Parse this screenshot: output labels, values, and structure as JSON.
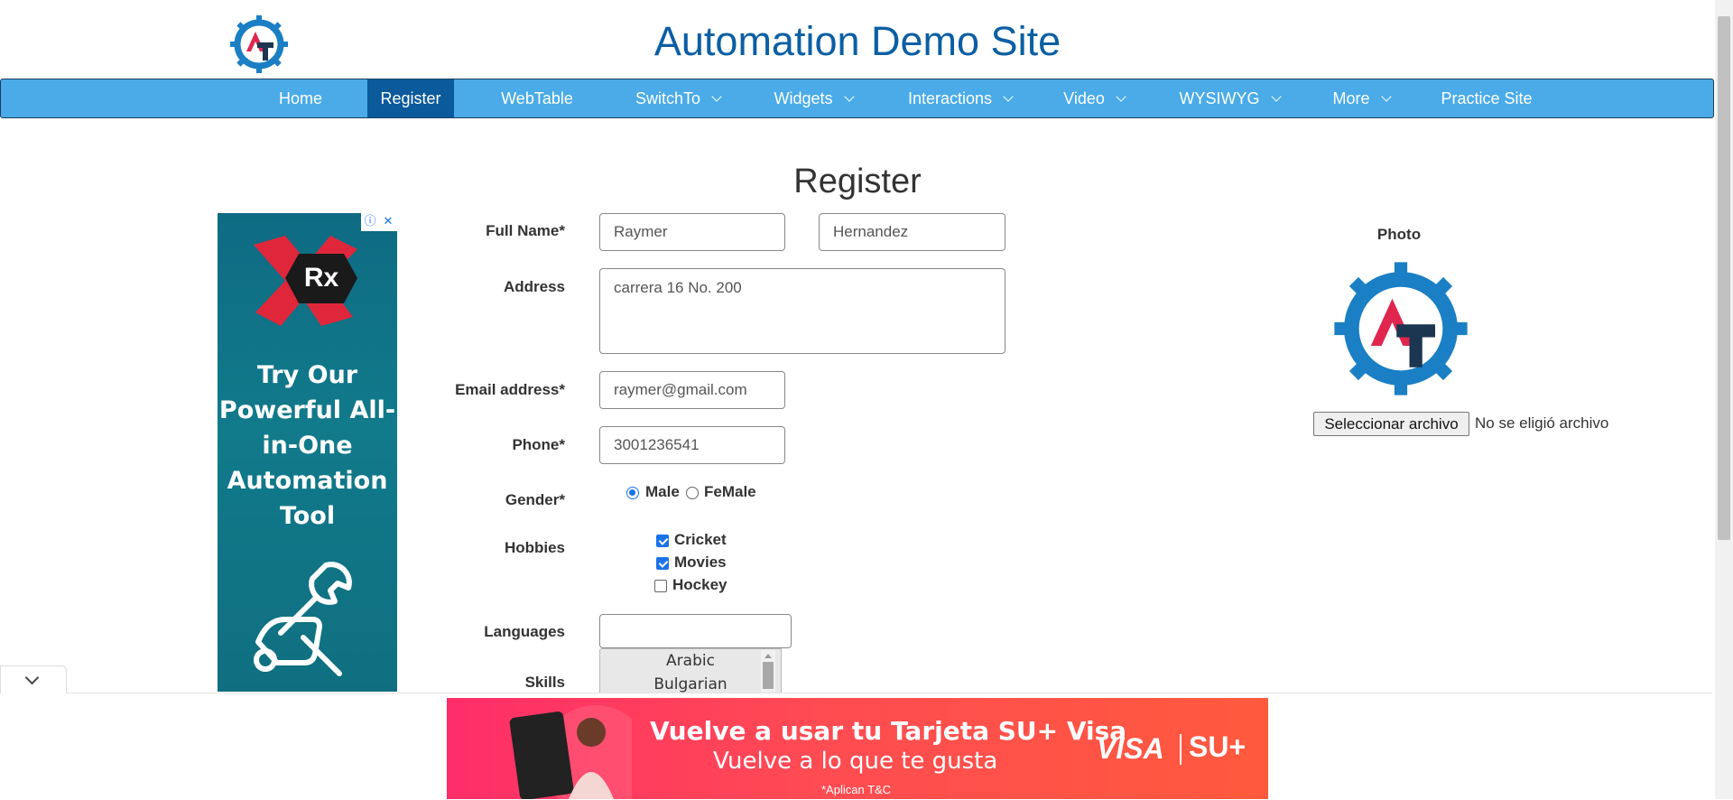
{
  "header": {
    "title": "Automation Demo Site",
    "logo": "gear-logo-icon"
  },
  "nav": {
    "items": [
      {
        "label": "Home"
      },
      {
        "label": "Register",
        "active": true
      },
      {
        "label": "WebTable"
      },
      {
        "label": "SwitchTo",
        "dropdown": true
      },
      {
        "label": "Widgets",
        "dropdown": true
      },
      {
        "label": "Interactions",
        "dropdown": true
      },
      {
        "label": "Video",
        "dropdown": true
      },
      {
        "label": "WYSIWYG",
        "dropdown": true
      },
      {
        "label": "More",
        "dropdown": true
      },
      {
        "label": "Practice Site"
      }
    ]
  },
  "page": {
    "heading": "Register"
  },
  "ad_left": {
    "badge_info": "ⓘ",
    "badge_close": "✕",
    "brand": "Rx",
    "text": "Try Our Powerful All-in-One Automation Tool"
  },
  "form": {
    "full_name_label": "Full Name*",
    "first_name": "Raymer",
    "last_name": "Hernandez",
    "address_label": "Address",
    "address": "carrera 16 No. 200",
    "email_label": "Email address*",
    "email": "raymer@gmail.com",
    "phone_label": "Phone*",
    "phone": "3001236541",
    "gender_label": "Gender*",
    "gender_male": "Male",
    "gender_female": "FeMale",
    "hobbies_label": "Hobbies",
    "hobby_cricket": "Cricket",
    "hobby_movies": "Movies",
    "hobby_hockey": "Hockey",
    "languages_label": "Languages",
    "languages_value": "",
    "skills_label": "Skills",
    "skills_options": [
      "Arabic",
      "Bulgarian"
    ]
  },
  "photo": {
    "label": "Photo",
    "button": "Seleccionar archivo",
    "status": "No se eligió archivo"
  },
  "bottom_ad": {
    "line1": "Vuelve a usar tu Tarjeta SU+ Visa",
    "line2": "Vuelve a lo que te gusta",
    "line3": "*Aplican T&C",
    "visa": "VISA",
    "su": "SU+"
  },
  "colors": {
    "nav_bg": "#4aabe8",
    "nav_active": "#0b5a9c",
    "title": "#0b5fa4",
    "ad_left_bg": "#0e6b83",
    "bottom_ad_bg": "#ff3d5a"
  }
}
